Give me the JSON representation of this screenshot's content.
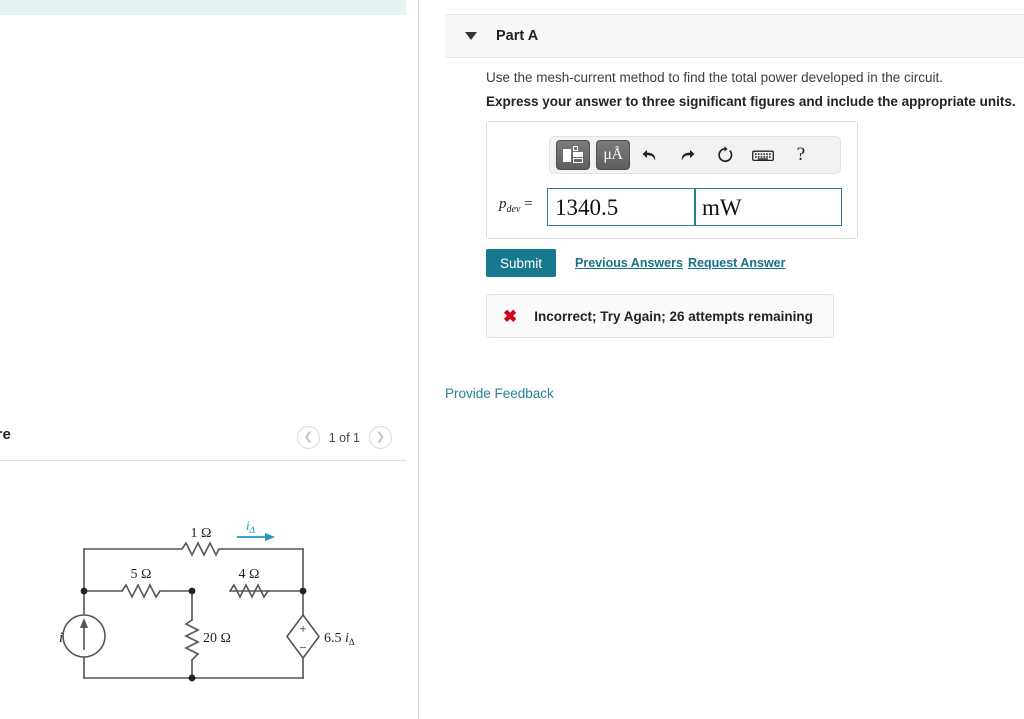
{
  "left_panel": {
    "banner_text": "",
    "figure_title": "Figure",
    "pager": {
      "prev_icon": "chevron-left-icon",
      "next_icon": "chevron-right-icon",
      "label": "1 of 1"
    },
    "figure": {
      "caption": "",
      "circuit": {
        "source_label": "i",
        "top_resistor": "1 Ω",
        "left_resistor": "5 Ω",
        "right_resistor": "4 Ω",
        "middle_resistor": "20 Ω",
        "current_label": "iΔ",
        "dependent_source_label": "6.5 iΔ",
        "dependent_source_plus": "+",
        "dependent_source_minus": "−",
        "accent_color": "#2196c4",
        "wire_color": "#555555"
      }
    }
  },
  "right_panel": {
    "part": {
      "title": "Part A",
      "caret_icon": "caret-down-icon"
    },
    "question": {
      "prompt": "Use the mesh-current method to find the total power developed in the circuit.",
      "instruction": "Express your answer to three significant figures and include the appropriate units."
    },
    "answer": {
      "label_symbol": "p",
      "label_subscript": "dev",
      "label_equals": "=",
      "value": "1340.5",
      "unit": "mW",
      "value_placeholder": "",
      "unit_placeholder": "",
      "border_color": "#2a7f92",
      "toolbar": {
        "template_icon": "math-template-icon",
        "units_label": "μÅ",
        "undo_icon": "undo-arrow-icon",
        "redo_icon": "redo-arrow-icon",
        "reset_icon": "reset-circle-icon",
        "keyboard_icon": "keyboard-icon",
        "help_label": "?"
      }
    },
    "actions": {
      "submit_label": "Submit",
      "previous_answers_label": "Previous Answers",
      "request_answer_label": "Request Answer",
      "submit_color": "#18788f",
      "link_color": "#17718a"
    },
    "feedback": {
      "icon": "x-mark-icon",
      "icon_color": "#d0021b",
      "message": "Incorrect; Try Again; 26 attempts remaining"
    },
    "provide_feedback_label": "Provide Feedback"
  }
}
